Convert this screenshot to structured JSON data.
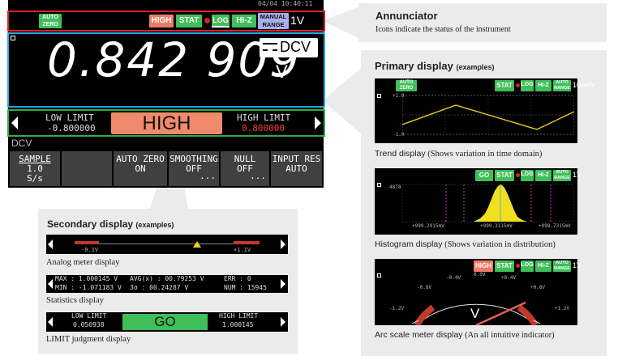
{
  "top_status": "04/04 10:40:11",
  "annunciator": {
    "auto_zero": "AUTO ZERO",
    "high": "HIGH",
    "stat": "STAT",
    "log": "LOG",
    "hiz": "HI-Z",
    "manual_range": "MANUAL RANGE",
    "range": "1V",
    "callout_title": "Annunciator",
    "callout_desc": "Icons indicate the status of the instrument"
  },
  "primary": {
    "value": "0.842 909",
    "unit": "V",
    "function": "DCV",
    "callout_title": "Primary display",
    "callout_sub": "(examples)"
  },
  "limit_bar": {
    "low_label": "LOW LIMIT",
    "low_value": "-0.800000",
    "judgment": "HIGH",
    "high_label": "HIGH LIMIT",
    "high_value": "0.800000"
  },
  "function_label": "DCV",
  "softkeys": [
    {
      "label": "SAMPLE",
      "value": "1.0",
      "value2": "S/s"
    },
    {
      "label": "",
      "value": "",
      "value2": ""
    },
    {
      "label": "AUTO ZERO",
      "value": "ON",
      "value2": ""
    },
    {
      "label": "SMOOTHING",
      "value": "OFF",
      "value2": "..."
    },
    {
      "label": "NULL",
      "value": "OFF",
      "value2": "..."
    },
    {
      "label": "INPUT RES",
      "value": "AUTO",
      "value2": ""
    }
  ],
  "secondary": {
    "title": "Secondary display",
    "title_sub": "(examples)",
    "analog": {
      "left": "-0.1V",
      "right": "+1.1V",
      "caption": "Analog meter display"
    },
    "stats": {
      "max": "MAX : 1.000145 V",
      "min": "MIN : -1.071183 V",
      "avg": "AVG(x) : 00.79253 V",
      "sigma": "3σ  : 00.24287 V",
      "err": "ERR : 0",
      "num": "NUM : 15945",
      "caption": "Statistics display"
    },
    "limit": {
      "low_label": "LOW LIMIT",
      "low_value": "0.050938",
      "judgment": "GO",
      "high_label": "HIGH LIMIT",
      "high_value": "1.000145",
      "caption": "LIMIT judgment display"
    }
  },
  "trend": {
    "tags": [
      "AUTO ZERO",
      "STAT",
      "LOG",
      "HI-Z",
      "AUTO RANGE"
    ],
    "range": "100mV",
    "ytop": "+1.0",
    "ybot": "-1.0",
    "caption_a": "Trend display",
    "caption_b": "(Shows variation in time domain)"
  },
  "histogram": {
    "tags": [
      "GO",
      "STAT",
      "LOG",
      "HI-Z",
      "AUTO RANGE"
    ],
    "range": "1V",
    "ylabel": "4878",
    "xleft": "+999.2915mV",
    "xmid": "+999.3115mV",
    "xright": "+999.7315mV",
    "caption_a": "Histogram display",
    "caption_b": "(Shows variation in distribution)"
  },
  "arc": {
    "tags": [
      "HIGH",
      "STAT",
      "LOG",
      "HI-Z",
      "AUTO RANGE"
    ],
    "range": "1V",
    "scale": [
      "-1.2V",
      "-0.8V",
      "-0.4V",
      "0.0V",
      "+0.4V",
      "+0.8V",
      "+1.2V"
    ],
    "unit": "V",
    "caption_a": "Arc scale meter display",
    "caption_b": "(An all intuitive indicator)"
  },
  "colors": {
    "annunciator_frame": "#e0202a",
    "primary_frame": "#2aa7e0",
    "limit_frame": "#2fae4a",
    "judgment_high": "#f08a6c",
    "judgment_go": "#3fbf5a"
  }
}
